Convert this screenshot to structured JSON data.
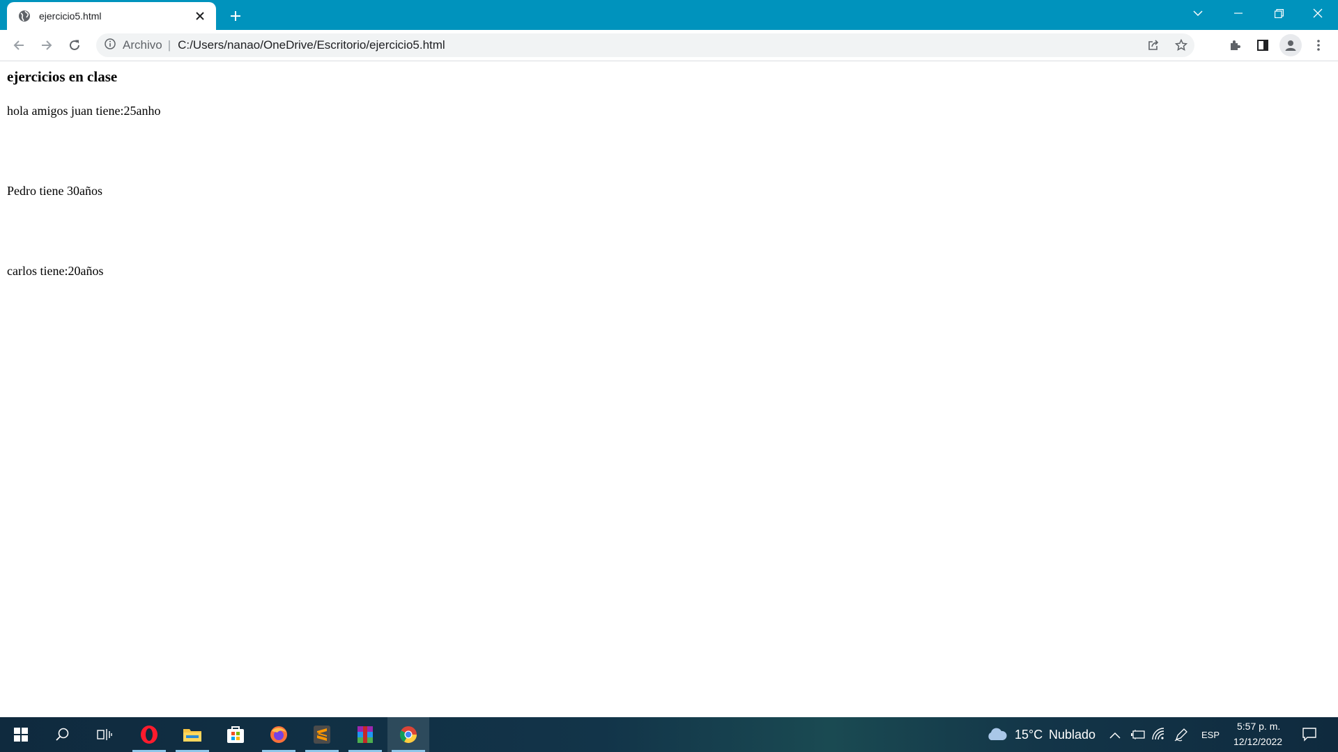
{
  "browser": {
    "tab": {
      "title": "ejercicio5.html"
    },
    "address_bar": {
      "scheme_chip": "Archivo",
      "separator": "|",
      "url": "C:/Users/nanao/OneDrive/Escritorio/ejercicio5.html"
    }
  },
  "page": {
    "heading": "ejercicios en clase",
    "lines": [
      "hola amigos juan tiene:25anho",
      "Pedro tiene 30años",
      "carlos tiene:20años"
    ]
  },
  "taskbar": {
    "weather": {
      "temp": "15°C",
      "condition": "Nublado"
    },
    "language": "ESP",
    "clock": {
      "time": "5:57 p. m.",
      "date": "12/12/2022"
    },
    "apps": [
      "start-icon",
      "search-icon",
      "task-view-icon",
      "opera-icon",
      "file-explorer-icon",
      "store-icon",
      "firefox-icon",
      "sublime-text-icon",
      "winrar-icon",
      "chrome-icon"
    ]
  },
  "colors": {
    "tabstrip": "#0093bd",
    "omnibox": "#f1f3f4",
    "taskbar": "#123449"
  }
}
